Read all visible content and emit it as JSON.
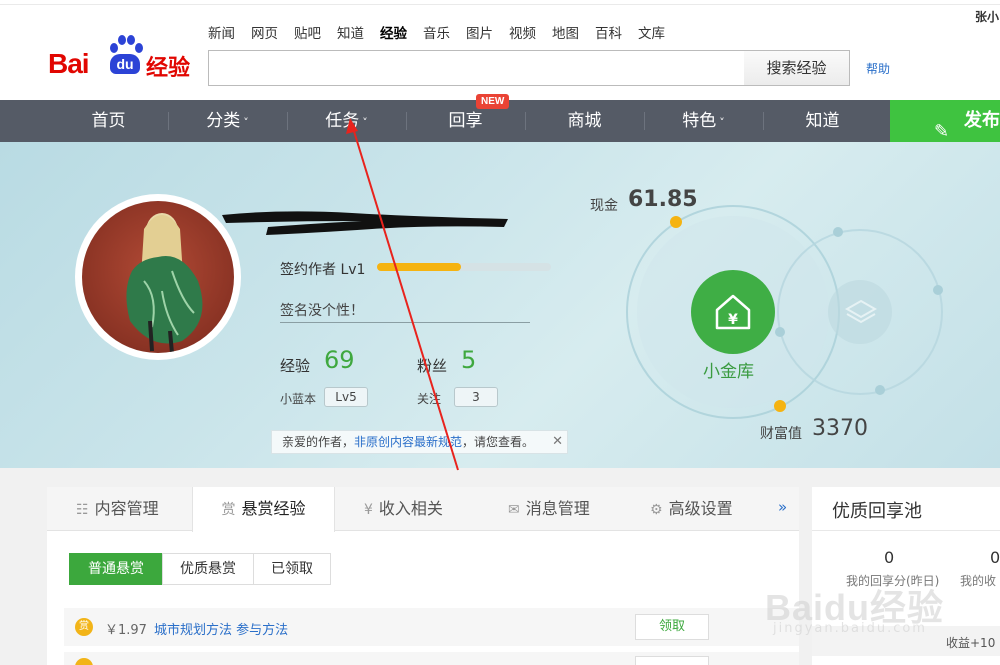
{
  "header": {
    "logo_text": "Baidu经验",
    "logo_bai": "Bai",
    "logo_du": "du",
    "logo_jingyan": "经验",
    "nav": [
      "新闻",
      "网页",
      "贴吧",
      "知道",
      "经验",
      "音乐",
      "图片",
      "视频",
      "地图",
      "百科",
      "文库"
    ],
    "active_nav": "经验",
    "search_placeholder": "",
    "search_button": "搜索经验",
    "help": "帮助",
    "user": "张小"
  },
  "main_nav": {
    "items": [
      {
        "label": "首页",
        "caret": ""
      },
      {
        "label": "分类",
        "caret": "˅"
      },
      {
        "label": "任务",
        "caret": "˅"
      },
      {
        "label": "回享",
        "caret": ""
      },
      {
        "label": "商城",
        "caret": ""
      },
      {
        "label": "特色",
        "caret": "˅"
      },
      {
        "label": "知道",
        "caret": ""
      }
    ],
    "new_badge": "NEW",
    "publish": "发布",
    "publish_icon": "pen-icon"
  },
  "profile": {
    "signed_author": "签约作者 Lv1",
    "level_progress": 0.48,
    "motto": "签名没个性！",
    "exp_label": "经验",
    "exp_value": "69",
    "fans_label": "粉丝",
    "fans_value": "5",
    "xiaolanben_label": "小蓝本",
    "xiaolanben_value": "Lv5",
    "follow_label": "关注",
    "follow_value": "3",
    "notice_prefix": "亲爱的作者，",
    "notice_link": "非原创内容最新规范",
    "notice_suffix": "，请您查看。",
    "notice_close": "✕"
  },
  "wallet": {
    "cash_label": "现金",
    "cash_value": "61.85",
    "vault_label": "小金库",
    "wealth_label": "财富值",
    "wealth_value": "3370"
  },
  "tabs": {
    "items": [
      {
        "icon": "☷",
        "label": "内容管理"
      },
      {
        "icon": "赏",
        "label": "悬赏经验"
      },
      {
        "icon": "¥",
        "label": "收入相关"
      },
      {
        "icon": "✉",
        "label": "消息管理"
      },
      {
        "icon": "⚙",
        "label": "高级设置"
      }
    ],
    "active": "悬赏经验",
    "more": "»"
  },
  "subtabs": [
    "普通悬赏",
    "优质悬赏",
    "已领取"
  ],
  "reward_rows": [
    {
      "coin": "赏",
      "price": "￥1.97",
      "title": "城市规划方法 参与方法",
      "action": "领取"
    }
  ],
  "pool": {
    "title": "优质回享池",
    "num1": "0",
    "num2": "0",
    "label1": "我的回享分(昨日)",
    "label2": "我的收",
    "gain": "收益+10"
  },
  "watermark": {
    "line1": "Baidu经验",
    "line2": "jingyan.baidu.com"
  },
  "colors": {
    "brand_red": "#e10601",
    "nav_bg": "#555b66",
    "green": "#3fc340",
    "accent_orange": "#f5b311",
    "arrow_red": "#e8231d"
  }
}
